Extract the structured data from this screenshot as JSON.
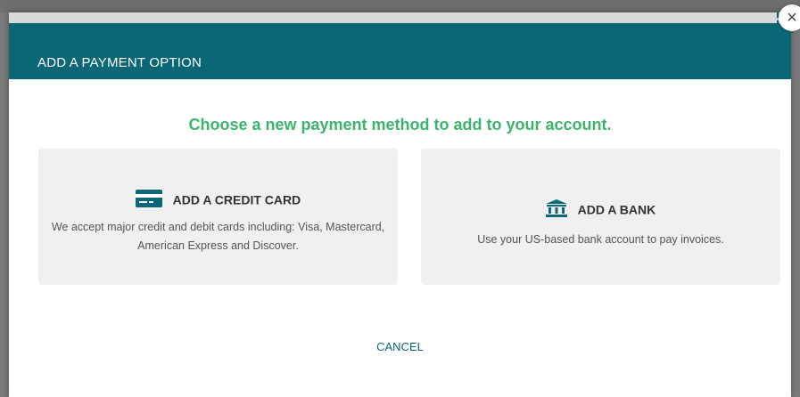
{
  "modal": {
    "title": "ADD A PAYMENT OPTION",
    "close_label": "×",
    "subtitle": "Choose a new payment method to add to your account.",
    "cancel_label": "CANCEL"
  },
  "options": [
    {
      "icon": "credit-card-icon",
      "label": "ADD A CREDIT CARD",
      "description": "We accept major credit and debit cards including: Visa, Mastercard, American Express and Discover."
    },
    {
      "icon": "bank-icon",
      "label": "ADD A BANK",
      "description": "Use your US-based bank account to pay invoices."
    }
  ],
  "colors": {
    "header_bg": "#0b6675",
    "accent_green": "#3cb46e",
    "card_bg": "#f0f0f0",
    "link": "#0b6675"
  }
}
